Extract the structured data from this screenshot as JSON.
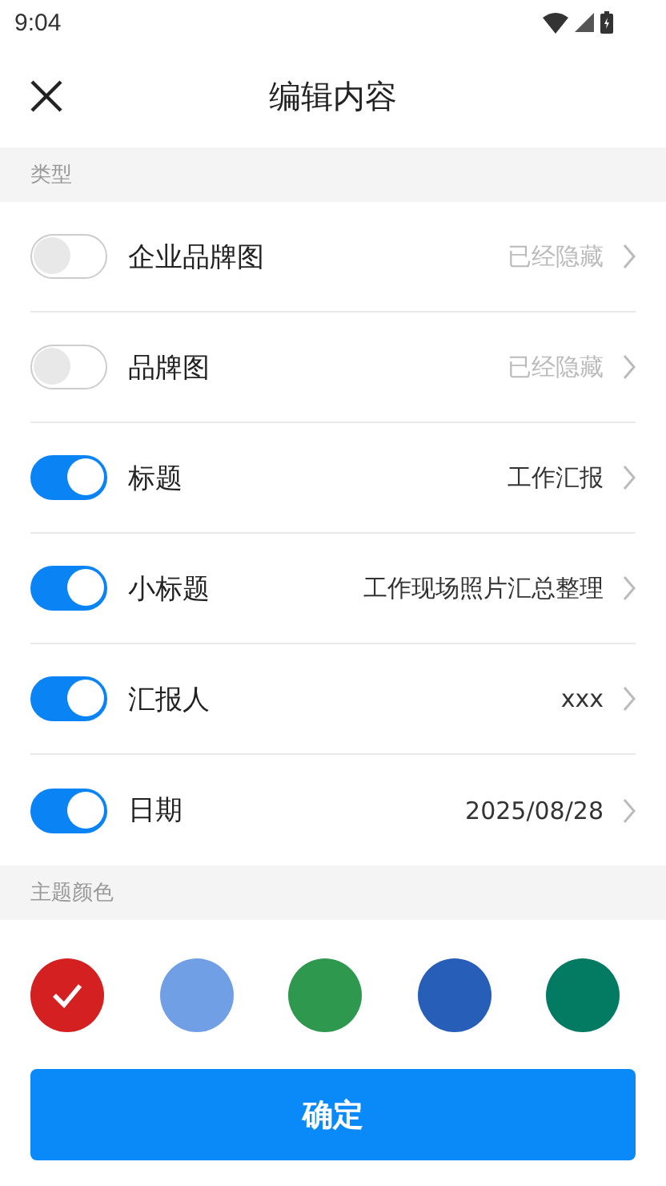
{
  "status_bar": {
    "time": "9:04"
  },
  "header": {
    "title": "编辑内容"
  },
  "type_section": {
    "label": "类型",
    "rows": [
      {
        "label": "企业品牌图",
        "value": "已经隐藏",
        "on": false
      },
      {
        "label": "品牌图",
        "value": "已经隐藏",
        "on": false
      },
      {
        "label": "标题",
        "value": "工作汇报",
        "on": true
      },
      {
        "label": "小标题",
        "value": "工作现场照片汇总整理",
        "on": true
      },
      {
        "label": "汇报人",
        "value": "xxx",
        "on": true
      },
      {
        "label": "日期",
        "value": "2025/08/28",
        "on": true
      }
    ]
  },
  "color_section": {
    "label": "主题颜色",
    "colors": [
      {
        "color": "#d42020",
        "selected": true
      },
      {
        "color": "#719fe6",
        "selected": false
      },
      {
        "color": "#2e994e",
        "selected": false
      },
      {
        "color": "#275fb8",
        "selected": false
      },
      {
        "color": "#037a62",
        "selected": false
      }
    ]
  },
  "confirm_button": "确定"
}
